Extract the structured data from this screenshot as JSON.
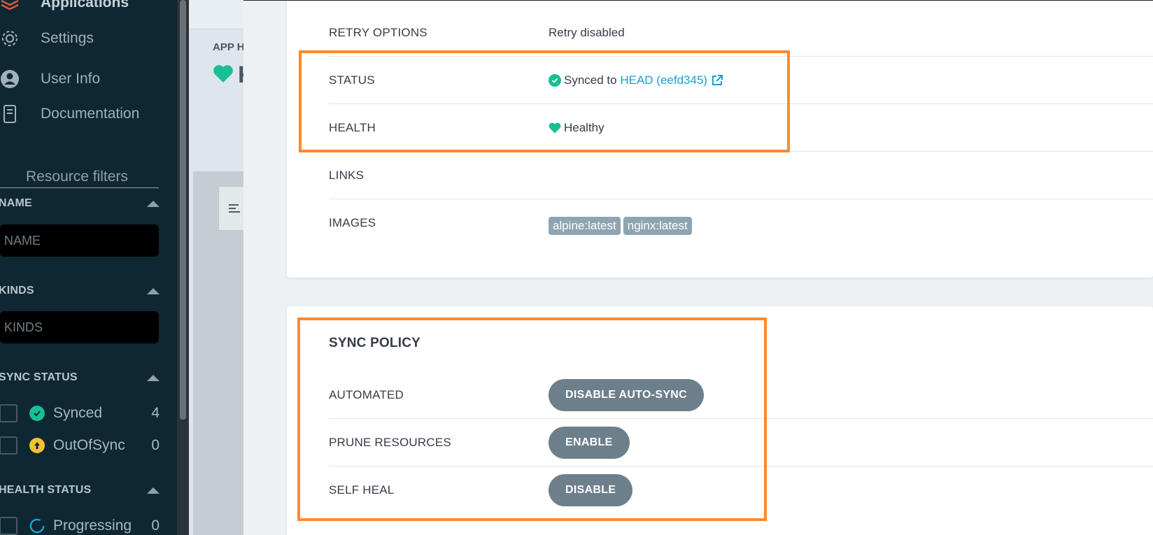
{
  "sidebar": {
    "nav": [
      {
        "label": "Applications",
        "icon": "layers-icon"
      },
      {
        "label": "Settings",
        "icon": "gear-icon"
      },
      {
        "label": "User Info",
        "icon": "user-circle-icon"
      },
      {
        "label": "Documentation",
        "icon": "book-icon"
      }
    ],
    "resource_filters_title": "Resource filters",
    "name_filter": {
      "heading": "NAME",
      "placeholder": "NAME"
    },
    "kinds_filter": {
      "heading": "KINDS",
      "placeholder": "KINDS"
    },
    "sync_status": {
      "heading": "SYNC STATUS",
      "items": [
        {
          "label": "Synced",
          "count": "4",
          "color": "#18be94"
        },
        {
          "label": "OutOfSync",
          "count": "0",
          "color": "#f4c030"
        }
      ]
    },
    "health_status": {
      "heading": "HEALTH STATUS",
      "items": [
        {
          "label": "Progressing",
          "count": "0",
          "color": "#0dadea"
        }
      ]
    }
  },
  "background": {
    "app_header_label": "APP H",
    "app_name_fragment": "K"
  },
  "summary": {
    "rows": {
      "retry_options": {
        "label": "RETRY OPTIONS",
        "value": "Retry disabled"
      },
      "status": {
        "label": "STATUS",
        "value_prefix": "Synced to",
        "link_text": "HEAD (eefd345)"
      },
      "health": {
        "label": "HEALTH",
        "value": "Healthy"
      },
      "links": {
        "label": "LINKS"
      },
      "images": {
        "label": "IMAGES",
        "tags": [
          "alpine:latest",
          "nginx:latest"
        ]
      }
    }
  },
  "sync_policy": {
    "title": "SYNC POLICY",
    "rows": {
      "automated": {
        "label": "AUTOMATED",
        "button": "DISABLE AUTO-SYNC"
      },
      "prune": {
        "label": "PRUNE RESOURCES",
        "button": "ENABLE"
      },
      "self_heal": {
        "label": "SELF HEAL",
        "button": "DISABLE"
      }
    }
  },
  "colors": {
    "sidebar_bg": "#0e2733",
    "highlight": "#ff8a2b",
    "healthy": "#18be94",
    "link": "#1c9ed0",
    "pill_button": "#6d7f8b"
  }
}
